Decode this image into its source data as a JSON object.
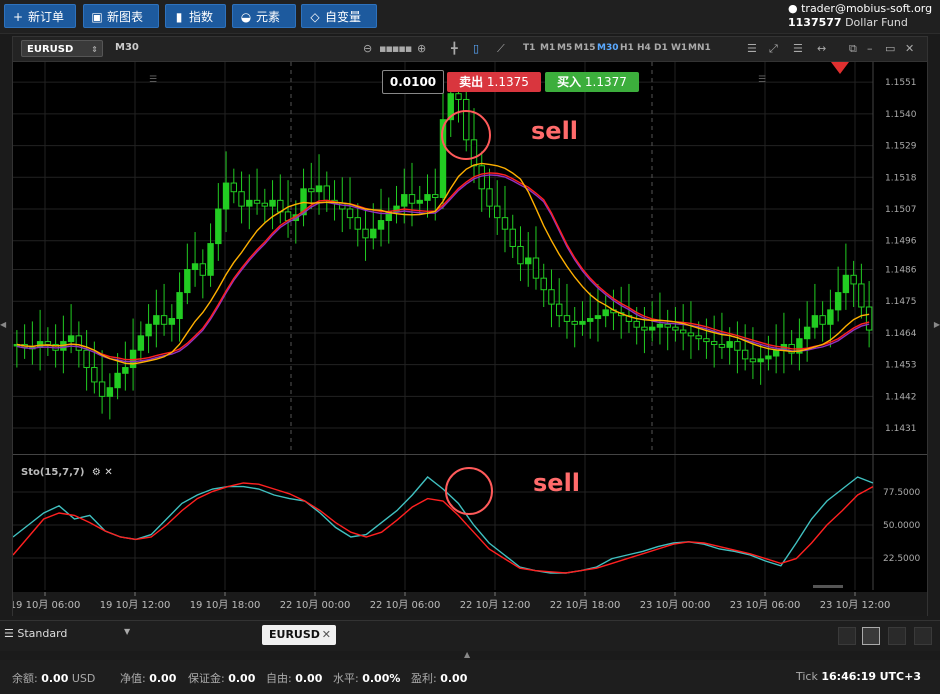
{
  "toolbar": {
    "new_order": "新订单",
    "new_chart": "新图表",
    "indicators": "指数",
    "elements": "元素",
    "custom_vars": "自变量"
  },
  "account": {
    "user": "trader@mobius-soft.org",
    "number": "1137577",
    "fund": "Dollar Fund"
  },
  "chart_toolbar": {
    "symbol": "EURUSD",
    "timeframe": "M30",
    "timeframes": [
      "T1",
      "M1",
      "M5",
      "M15",
      "M30",
      "H1",
      "H4",
      "D1",
      "W1",
      "MN1"
    ],
    "active_timeframe": "M30"
  },
  "trade_panel": {
    "lot": "0.0100",
    "sell_label": "卖出",
    "sell_price": "1.1375",
    "buy_label": "买入",
    "buy_price": "1.1377"
  },
  "annotations": {
    "sell_top": "sell",
    "sell_bottom": "sell"
  },
  "indicator_label": "Sto(15,7,7)",
  "bottom": {
    "workspace": "Standard",
    "doc_tab": "EURUSD"
  },
  "status": {
    "balance_label": "余额:",
    "balance_value": "0.00",
    "balance_ccy": "USD",
    "equity_label": "净值:",
    "equity_value": "0.00",
    "margin_label": "保证金:",
    "margin_value": "0.00",
    "free_label": "自由:",
    "free_value": "0.00",
    "level_label": "水平:",
    "level_value": "0.00%",
    "profit_label": "盈利:",
    "profit_value": "0.00",
    "tick_label": "Tick",
    "time": "16:46:19",
    "tz": "UTC+3"
  },
  "colors": {
    "bull": "#22cc22",
    "ma_fast": "#ffb000",
    "ma_slow": "#ff2020",
    "ma_purple": "#9030c0",
    "sto_k": "#40c0c0",
    "sto_d": "#ff2020",
    "sell": "#d9363e",
    "buy": "#3cae3c",
    "accent": "#1d5a9e"
  },
  "chart_data": [
    {
      "type": "candlestick",
      "title": "",
      "price_ticks": [
        "1.1551",
        "1.1540",
        "1.1529",
        "1.1518",
        "1.1507",
        "1.1496",
        "1.1486",
        "1.1475",
        "1.1464",
        "1.1453",
        "1.1442",
        "1.1431"
      ],
      "ylim": [
        1.1422,
        1.1558
      ],
      "time_ticks": [
        "19 10月 06:00",
        "19 10月 12:00",
        "19 10月 18:00",
        "22 10月 00:00",
        "22 10月 06:00",
        "22 10月 12:00",
        "22 10月 18:00",
        "23 10月 00:00",
        "23 10月 06:00",
        "23 10月 12:00"
      ],
      "close": [
        1.146,
        1.1459,
        1.1459,
        1.1461,
        1.146,
        1.1458,
        1.1461,
        1.1463,
        1.1458,
        1.1452,
        1.1447,
        1.1442,
        1.1445,
        1.145,
        1.1452,
        1.1458,
        1.1463,
        1.1467,
        1.147,
        1.1467,
        1.1469,
        1.1478,
        1.1486,
        1.1488,
        1.1484,
        1.1495,
        1.1507,
        1.1516,
        1.1513,
        1.1508,
        1.151,
        1.1509,
        1.1508,
        1.151,
        1.1506,
        1.1503,
        1.1505,
        1.1514,
        1.1513,
        1.1515,
        1.151,
        1.1509,
        1.1507,
        1.1504,
        1.15,
        1.1497,
        1.15,
        1.1503,
        1.1506,
        1.1508,
        1.1512,
        1.1509,
        1.151,
        1.1512,
        1.1511,
        1.1538,
        1.1547,
        1.1545,
        1.1531,
        1.1522,
        1.1514,
        1.1508,
        1.1504,
        1.15,
        1.1494,
        1.1488,
        1.149,
        1.1483,
        1.1479,
        1.1474,
        1.147,
        1.1468,
        1.1467,
        1.1468,
        1.1469,
        1.147,
        1.1472,
        1.1471,
        1.147,
        1.1468,
        1.1466,
        1.1465,
        1.1466,
        1.1467,
        1.1466,
        1.1465,
        1.1464,
        1.1463,
        1.1462,
        1.1461,
        1.146,
        1.1459,
        1.1461,
        1.1458,
        1.1455,
        1.1454,
        1.1455,
        1.1456,
        1.1458,
        1.146,
        1.1457,
        1.1462,
        1.1466,
        1.147,
        1.1467,
        1.1472,
        1.1478,
        1.1484,
        1.1481,
        1.1473,
        1.1465
      ]
    },
    {
      "type": "line",
      "title": "Sto(15,7,7)",
      "y_ticks": [
        "77.5000",
        "50.0000",
        "22.5000"
      ],
      "ylim": [
        0,
        100
      ]
    }
  ]
}
